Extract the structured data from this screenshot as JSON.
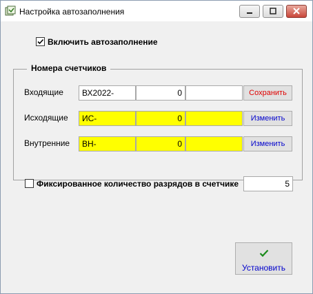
{
  "window": {
    "title": "Настройка автозаполнения",
    "icon": "app-icon"
  },
  "autofill": {
    "enabled_label": "Включить автозаполнение",
    "enabled": true
  },
  "counters": {
    "group_title": "Номера счетчиков",
    "rows": [
      {
        "label": "Входящие",
        "prefix": "ВХ2022-",
        "number": "0",
        "suffix": "",
        "button": "Сохранить",
        "button_color": "#e00000",
        "highlight": false
      },
      {
        "label": "Исходящие",
        "prefix": "ИС-",
        "number": "0",
        "suffix": "",
        "button": "Изменить",
        "button_color": "#0000cc",
        "highlight": true
      },
      {
        "label": "Внутренние",
        "prefix": "ВН-",
        "number": "0",
        "suffix": "",
        "button": "Изменить",
        "button_color": "#0000cc",
        "highlight": true
      }
    ]
  },
  "fixed_digits": {
    "label": "Фиксированное количество разрядов в счетчике",
    "checked": false,
    "value": "5"
  },
  "install_button": {
    "label": "Установить",
    "icon": "checkmark-icon"
  }
}
